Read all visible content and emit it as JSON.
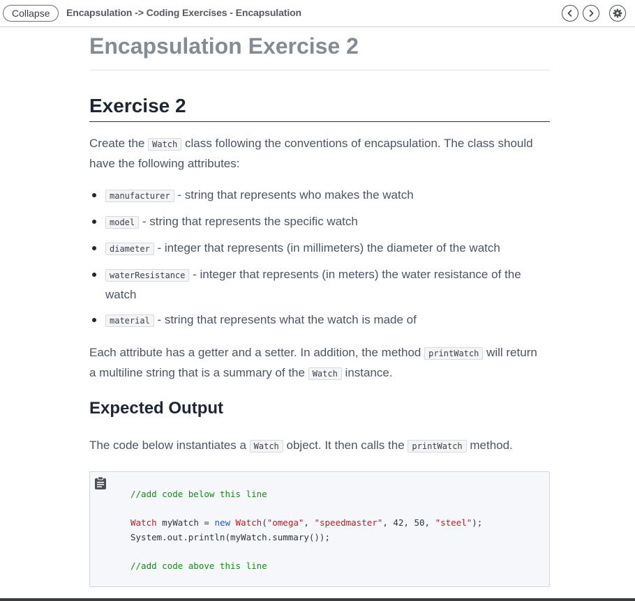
{
  "topbar": {
    "collapse_label": "Collapse",
    "breadcrumb": "Encapsulation -> Coding Exercises - Encapsulation",
    "icons": [
      "chevron-left-icon",
      "chevron-right-icon",
      "gear-icon"
    ]
  },
  "page": {
    "title": "Encapsulation Exercise 2",
    "heading": "Exercise 2",
    "intro": {
      "before": "Create the ",
      "code": "Watch",
      "after": " class following the conventions of encapsulation. The class should have the following attributes:"
    },
    "attributes": [
      {
        "name": "manufacturer",
        "desc": " - string that represents who makes the watch"
      },
      {
        "name": "model",
        "desc": " - string that represents the specific watch"
      },
      {
        "name": "diameter",
        "desc": " - integer that represents (in millimeters) the diameter of the watch"
      },
      {
        "name": "waterResistance",
        "desc": " - integer that represents (in meters) the water resistance of the watch"
      },
      {
        "name": "material",
        "desc": " - string that represents what the watch is made of"
      }
    ],
    "para2": {
      "part1": "Each attribute has a getter and a setter. In addition, the method ",
      "code1": "printWatch",
      "part2": " will return a multiline string that is a summary of the ",
      "code2": "Watch",
      "part3": " instance."
    },
    "expected_heading": "Expected Output",
    "para3": {
      "part1": "The code below instantiates a ",
      "code1": "Watch",
      "part2": " object. It then calls the ",
      "code2": "printWatch",
      "part3": " method."
    }
  },
  "codeblock": {
    "comment1": "//add code below this line",
    "l2_cls1": "Watch",
    "l2_var": " myWatch = ",
    "l2_new": "new",
    "l2_sp": " ",
    "l2_cls2": "Watch",
    "l2_open": "(",
    "l2_s1": "\"omega\"",
    "l2_c1": ", ",
    "l2_s2": "\"speedmaster\"",
    "l2_nums": ", 42, 50, ",
    "l2_s3": "\"steel\"",
    "l2_close": ");",
    "line3": "System.out.println(myWatch.summary());",
    "comment2": "//add code above this line"
  },
  "colors": {
    "heading": "#1e2634",
    "title_gray": "#858b93",
    "comment_green": "#178a17",
    "string_red": "#b31d28",
    "keyword_blue": "#1b58d6"
  }
}
